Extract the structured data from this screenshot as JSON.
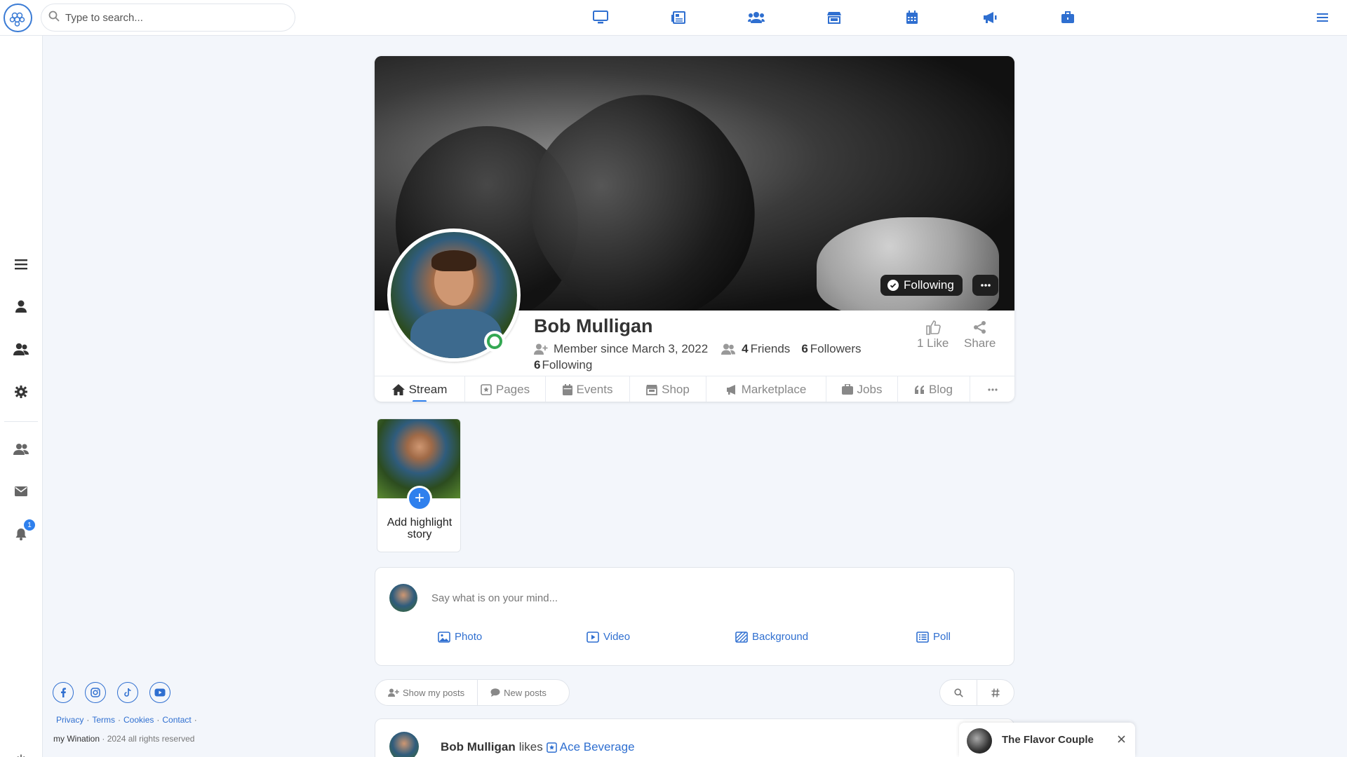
{
  "search": {
    "placeholder": "Type to search..."
  },
  "topnav": {
    "icons": [
      "desktop-icon",
      "newspaper-icon",
      "users-icon",
      "store-icon",
      "calendar-icon",
      "megaphone-icon",
      "briefcase-icon"
    ]
  },
  "sidebar": {
    "items": [
      "menu-icon",
      "user-icon",
      "friends-icon",
      "settings-icon",
      "group-icon",
      "mail-icon",
      "bell-icon"
    ],
    "notification_count": "1"
  },
  "profile": {
    "name": "Bob Mulligan",
    "member_since": "Member since March 3, 2022",
    "friends_count": "4",
    "friends_label": "Friends",
    "followers_count": "6",
    "followers_label": "Followers",
    "following_count": "6",
    "following_label": "Following",
    "follow_button": "Following",
    "like_label": "1 Like",
    "share_label": "Share"
  },
  "tabs": [
    {
      "label": "Stream"
    },
    {
      "label": "Pages"
    },
    {
      "label": "Events"
    },
    {
      "label": "Shop"
    },
    {
      "label": "Marketplace"
    },
    {
      "label": "Jobs"
    },
    {
      "label": "Blog"
    }
  ],
  "story": {
    "label": "Add highlight story"
  },
  "composer": {
    "placeholder": "Say what is on your mind...",
    "photo": "Photo",
    "video": "Video",
    "background": "Background",
    "poll": "Poll"
  },
  "filters": {
    "show_my_posts": "Show my posts",
    "new_posts": "New posts"
  },
  "post": {
    "author": "Bob Mulligan",
    "action": "likes",
    "target": "Ace Beverage"
  },
  "chat": {
    "name": "The Flavor Couple"
  },
  "footer": {
    "privacy": "Privacy",
    "terms": "Terms",
    "cookies": "Cookies",
    "contact": "Contact",
    "brand": "my Wination",
    "copyright": "· 2024 all rights reserved"
  },
  "colors": {
    "accent": "#2f80ed",
    "link": "#2f6fd0",
    "online": "#34a853"
  }
}
